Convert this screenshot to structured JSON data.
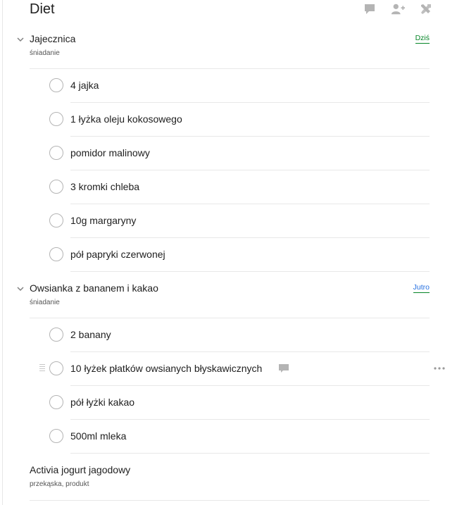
{
  "header": {
    "title": "Diet"
  },
  "colors": {
    "accent_blue": "#246fe0",
    "due_underline_green": "#058527",
    "icon_gray": "#b4b4b4"
  },
  "tasks": [
    {
      "name": "Jajecznica",
      "labels": "śniadanie",
      "due": "Dziś",
      "subtasks": [
        "4 jajka",
        "1 łyżka oleju kokosowego",
        "pomidor malinowy",
        "3 kromki chleba",
        "10g margaryny",
        "pół papryki czerwonej"
      ]
    },
    {
      "name": "Owsianka z bananem i kakao",
      "labels": "śniadanie",
      "due": "Jutro",
      "subtasks": [
        "2 banany",
        "10 łyżek płatków owsianych błyskawicznych",
        "pół łyżki kakao",
        "500ml mleka"
      ]
    },
    {
      "name": "Activia jogurt jagodowy",
      "labels": "przekąska, produkt"
    }
  ],
  "icons": {
    "comment": "comment-icon",
    "add_person": "add-person-icon",
    "settings": "settings-icon",
    "chevron": "chevron-down-icon",
    "drag": "drag-handle-icon",
    "more": "more-icon"
  }
}
